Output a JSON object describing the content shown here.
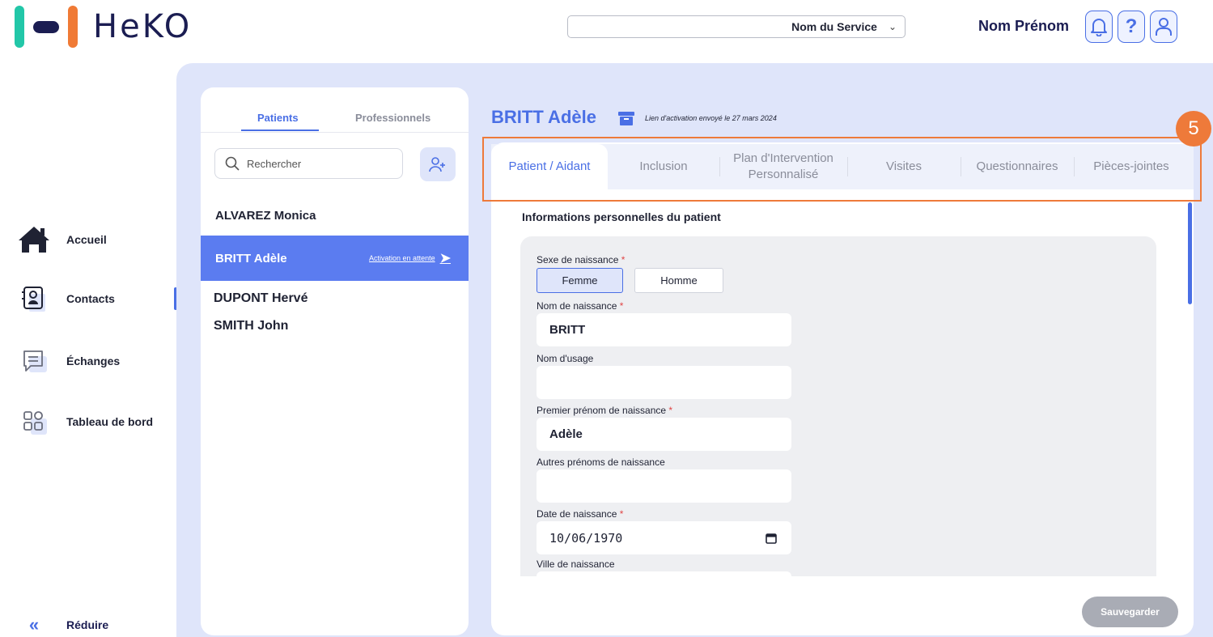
{
  "app": {
    "name": "HeKO"
  },
  "header": {
    "service_value": "Nom du Service",
    "user_name": "Nom Prénom",
    "help_label": "?"
  },
  "nav": {
    "items": [
      {
        "label": "Accueil",
        "icon": "home-icon"
      },
      {
        "label": "Contacts",
        "icon": "contacts-icon",
        "active": true
      },
      {
        "label": "Échanges",
        "icon": "chat-icon"
      },
      {
        "label": "Tableau de bord",
        "icon": "dashboard-icon"
      }
    ],
    "collapse_label": "Réduire",
    "collapse_icon": "«"
  },
  "contacts": {
    "tabs": [
      "Patients",
      "Professionnels"
    ],
    "search_placeholder": "Rechercher",
    "patients": [
      {
        "name": "ALVAREZ Monica"
      },
      {
        "name": "BRITT Adèle",
        "status": "Activation en attente",
        "selected": true
      },
      {
        "name": "DUPONT Hervé"
      },
      {
        "name": "SMITH John"
      }
    ]
  },
  "patient": {
    "name": "BRITT Adèle",
    "activation_note": "Lien d'activation envoyé le 27 mars 2024"
  },
  "tabs": [
    "Patient / Aidant",
    "Inclusion",
    "Plan d'Intervention Personnalisé",
    "Visites",
    "Questionnaires",
    "Pièces-jointes"
  ],
  "annotation": {
    "step": "5"
  },
  "form": {
    "section_title": "Informations personnelles du patient",
    "sexe_label": "Sexe de naissance",
    "sexe_options": [
      "Femme",
      "Homme"
    ],
    "sexe_selected": "Femme",
    "nom_naissance_label": "Nom de naissance",
    "nom_naissance_value": "BRITT",
    "nom_usage_label": "Nom d'usage",
    "nom_usage_value": "",
    "prenom_label": "Premier prénom de naissance",
    "prenom_value": "Adèle",
    "autres_prenoms_label": "Autres prénoms de naissance",
    "autres_prenoms_value": "",
    "date_label": "Date de naissance",
    "date_value": "10/06/1970",
    "ville_label": "Ville de naissance",
    "required_mark": "*"
  },
  "actions": {
    "save_label": "Sauvegarder"
  },
  "colors": {
    "primary": "#4a6fe5",
    "selected_row": "#5b7cf0",
    "annotation": "#ee7a3a",
    "background": "#dfe5fa",
    "brand_navy": "#1b1d52",
    "brand_teal": "#22c7a8",
    "brand_orange": "#f07a35"
  }
}
